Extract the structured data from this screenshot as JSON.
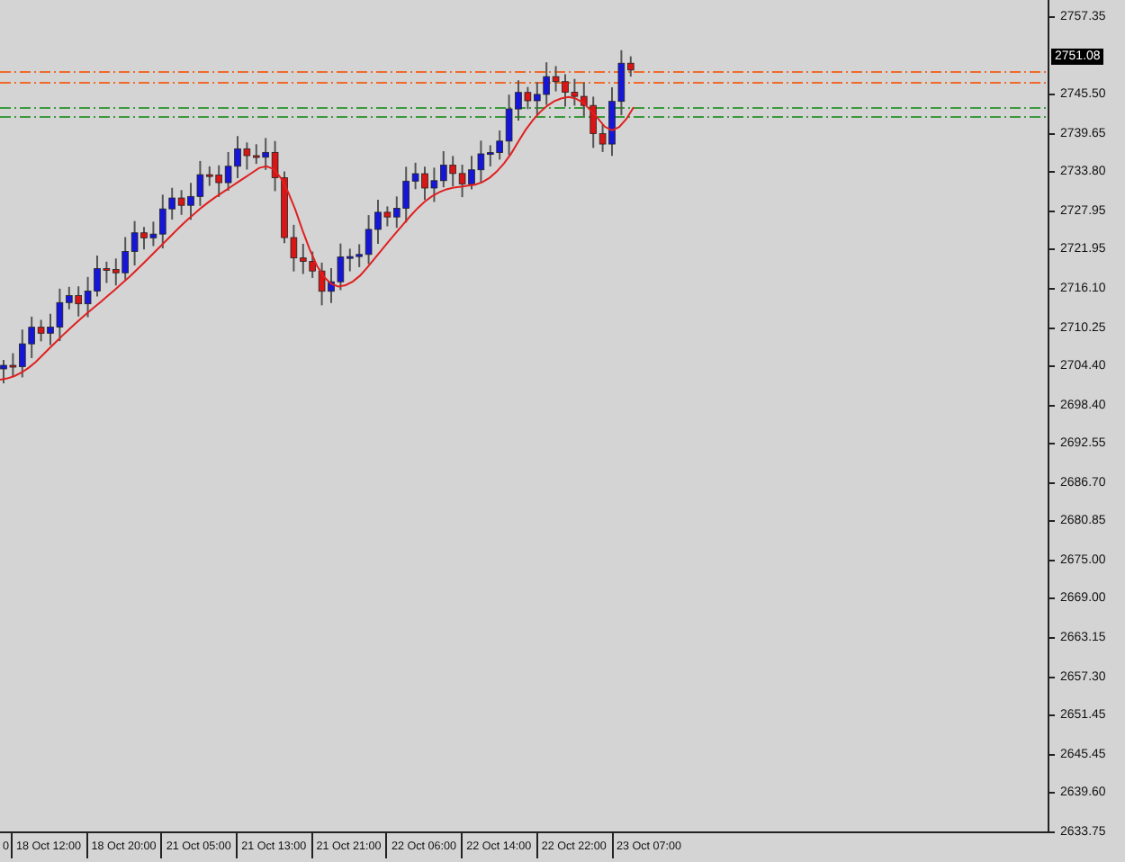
{
  "price_axis": {
    "labels": [
      "2757.35",
      "2745.50",
      "2739.65",
      "2733.80",
      "2727.95",
      "2721.95",
      "2716.10",
      "2710.25",
      "2704.40",
      "2698.40",
      "2692.55",
      "2686.70",
      "2680.85",
      "2675.00",
      "2669.00",
      "2663.15",
      "2657.30",
      "2651.45",
      "2645.45",
      "2639.60",
      "2633.75"
    ],
    "current_price": "2751.08"
  },
  "time_axis": {
    "labels": [
      "0",
      "18 Oct 12:00",
      "18 Oct 20:00",
      "21 Oct 05:00",
      "21 Oct 13:00",
      "21 Oct 21:00",
      "22 Oct 06:00",
      "22 Oct 14:00",
      "22 Oct 22:00",
      "23 Oct 07:00"
    ]
  }
}
